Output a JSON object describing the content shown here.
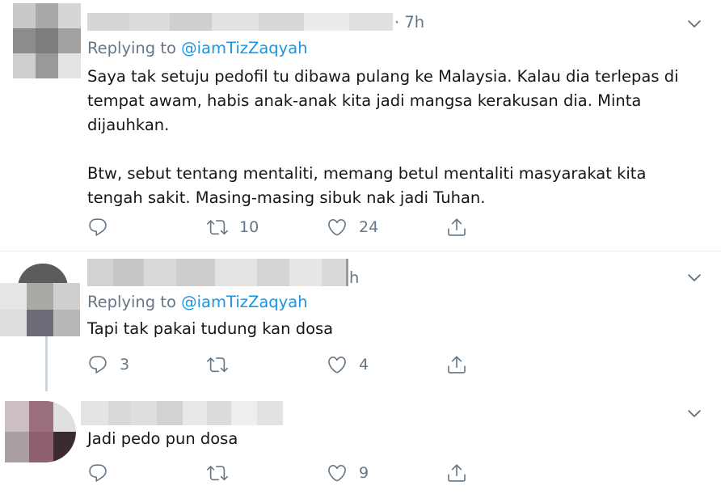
{
  "tweets": [
    {
      "time": "· 7h",
      "replying_prefix": "Replying to ",
      "replying_handle": "@iamTizZaqyah",
      "text": "Saya tak setuju pedofil tu dibawa pulang ke Malaysia. Kalau dia terlepas di\ntempat awam, habis anak-anak kita jadi mangsa kerakusan dia. Minta\ndijauhkan.\n\nBtw, sebut tentang mentaliti, memang betul mentaliti masyarakat kita\ntengah sakit. Masing-masing sibuk nak jadi Tuhan.",
      "reply_count": "",
      "retweet_count": "10",
      "like_count": "24"
    },
    {
      "time": "h",
      "replying_prefix": "Replying to ",
      "replying_handle": "@iamTizZaqyah",
      "text": "Tapi tak pakai tudung kan dosa",
      "reply_count": "3",
      "retweet_count": "",
      "like_count": "4"
    },
    {
      "time": "",
      "text": "Jadi pedo pun dosa",
      "reply_count": "",
      "retweet_count": "",
      "like_count": "9"
    }
  ],
  "colors": {
    "text": "#14171a",
    "secondary": "#657786",
    "link": "#1b95e0",
    "divider": "#e6ecf0"
  },
  "icons": [
    "reply-icon",
    "retweet-icon",
    "like-icon",
    "share-icon",
    "chevron-down-icon"
  ]
}
